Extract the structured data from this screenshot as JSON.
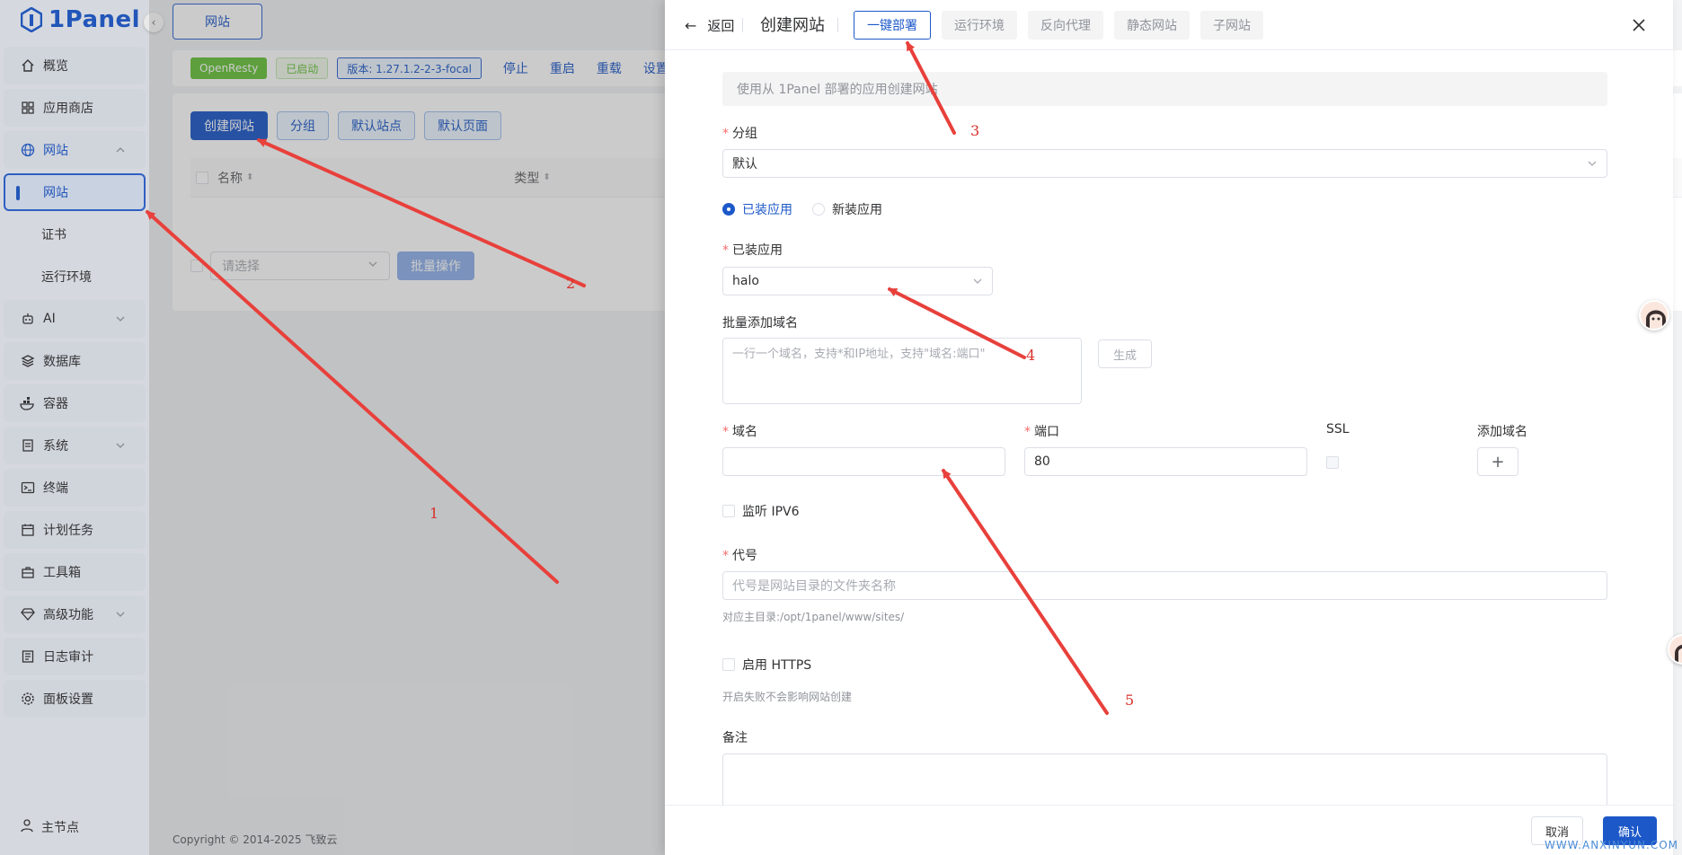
{
  "app": {
    "brand": "1Panel"
  },
  "sidebar": {
    "items": [
      {
        "label": "概览",
        "icon": "home-icon"
      },
      {
        "label": "应用商店",
        "icon": "apps-grid-icon"
      },
      {
        "label": "网站",
        "icon": "globe-icon",
        "expanded": true
      },
      {
        "label": "AI",
        "icon": "robot-icon"
      },
      {
        "label": "数据库",
        "icon": "database-icon"
      },
      {
        "label": "容器",
        "icon": "docker-icon"
      },
      {
        "label": "系统",
        "icon": "file-icon"
      },
      {
        "label": "终端",
        "icon": "terminal-icon"
      },
      {
        "label": "计划任务",
        "icon": "calendar-icon"
      },
      {
        "label": "工具箱",
        "icon": "toolbox-icon"
      },
      {
        "label": "高级功能",
        "icon": "diamond-icon"
      },
      {
        "label": "日志审计",
        "icon": "log-icon"
      },
      {
        "label": "面板设置",
        "icon": "settings-icon"
      }
    ],
    "website_sub": [
      "网站",
      "证书",
      "运行环境"
    ],
    "bottom": "主节点"
  },
  "main": {
    "page_tab": "网站",
    "status": {
      "tag_app": "OpenResty",
      "tag_state": "已启动",
      "tag_version": "版本: 1.27.1.2-2-3-focal",
      "ops": [
        "停止",
        "重启",
        "重载",
        "设置"
      ]
    },
    "toolbar": [
      "创建网站",
      "分组",
      "默认站点",
      "默认页面"
    ],
    "table": {
      "col_name": "名称",
      "col_type": "类型"
    },
    "batch": {
      "placeholder": "请选择",
      "button": "批量操作"
    },
    "footer": "Copyright © 2014-2025 飞致云"
  },
  "drawer": {
    "back": "返回",
    "title": "创建网站",
    "tabs": [
      "一键部署",
      "运行环境",
      "反向代理",
      "静态网站",
      "子网站"
    ],
    "active_tab": 0,
    "alert": "使用从 1Panel 部署的应用创建网站",
    "group_label": "分组",
    "group_value": "默认",
    "radios": [
      "已装应用",
      "新装应用"
    ],
    "installed_label": "已装应用",
    "installed_value": "halo",
    "batch_domain_label": "批量添加域名",
    "batch_domain_placeholder": "一行一个域名，支持*和IP地址，支持\"域名:端口\"",
    "generate": "生成",
    "domain_label": "域名",
    "port_label": "端口",
    "port_value": "80",
    "ssl_label": "SSL",
    "add_domain_label": "添加域名",
    "ipv6": "监听 IPV6",
    "alias_label": "代号",
    "alias_placeholder": "代号是网站目录的文件夹名称",
    "alias_hint": "对应主目录:/opt/1panel/www/sites/",
    "https": "启用 HTTPS",
    "https_hint": "开启失败不会影响网站创建",
    "remark_label": "备注",
    "cancel": "取消",
    "confirm": "确认"
  },
  "watermark": "WWW.ANXINYUN.COM",
  "annotations": [
    "1",
    "2",
    "3",
    "4",
    "5"
  ],
  "colors": {
    "primary": "#1d58c9",
    "annotation": "#e8403b",
    "success": "#67c23a"
  }
}
